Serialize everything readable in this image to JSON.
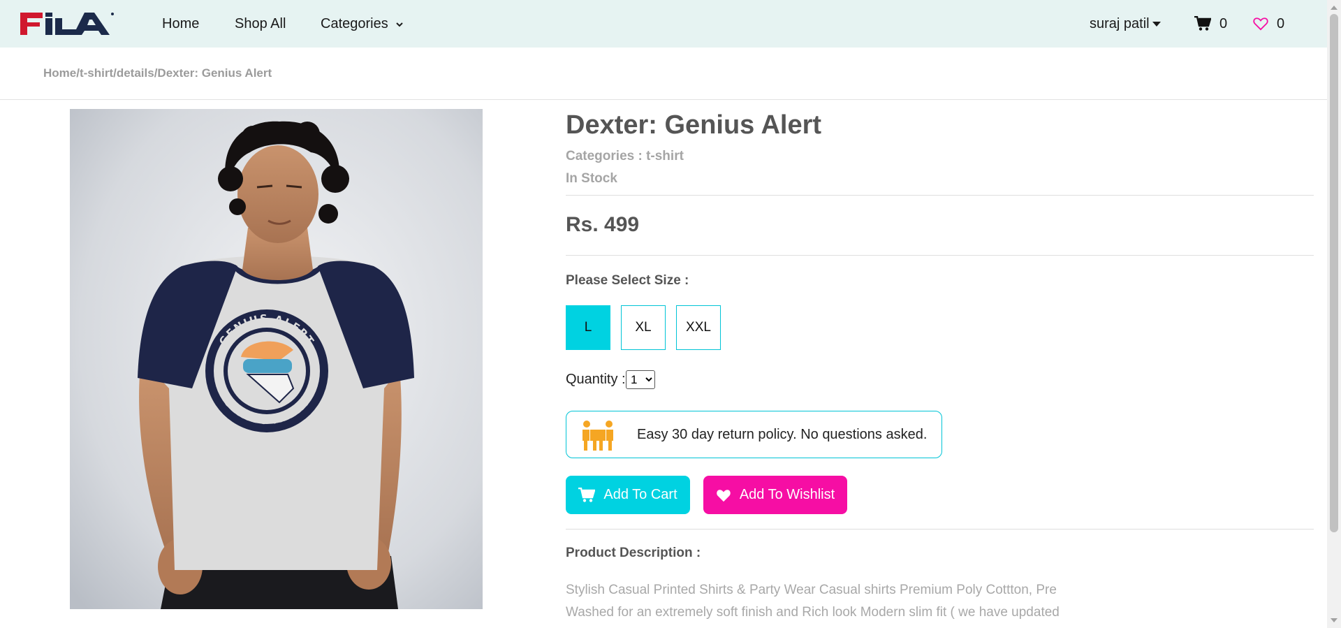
{
  "brand": {
    "logo_text": "FILA",
    "colors": {
      "navy": "#1b2a4a",
      "red": "#d0182e"
    }
  },
  "nav": {
    "home": "Home",
    "shop_all": "Shop All",
    "categories": "Categories",
    "user": "suraj patil",
    "cart_count": "0",
    "wishlist_count": "0"
  },
  "breadcrumb": "Home/t-shirt/details/Dexter: Genius Alert",
  "product": {
    "title": "Dexter: Genius Alert",
    "categories_line": "Categories : t-shirt",
    "stock": "In Stock",
    "price": "Rs. 499",
    "size_label": "Please Select Size :",
    "sizes": [
      "L",
      "XL",
      "XXL"
    ],
    "selected_size": "L",
    "quantity_label": "Quantity :",
    "quantity_value": "1",
    "return_policy": "Easy 30 day return policy. No questions asked.",
    "add_to_cart": "Add To Cart",
    "add_to_wishlist": "Add To Wishlist",
    "description_label": "Product Description :",
    "description": "Stylish Casual Printed Shirts & Party Wear Casual shirts Premium Poly Cottton, Pre Washed for an extremely soft finish and Rich look Modern slim fit ( we have updated",
    "shirt_print_text": "GENIUS ALERT"
  },
  "colors": {
    "accent_cyan": "#00d2e1",
    "accent_pink": "#f60ea4",
    "navbar_bg": "#e6f3f2",
    "return_icon": "#f5a623"
  },
  "icons": {
    "cart": "cart-icon",
    "wishlist": "heart-outline-icon",
    "dropdown": "chevron-down-icon",
    "return": "movers-box-icon"
  }
}
